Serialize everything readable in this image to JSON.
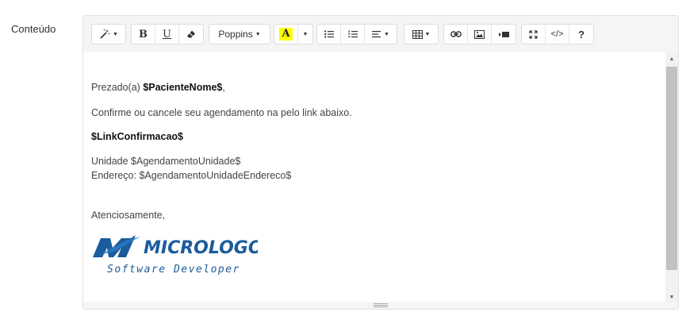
{
  "field": {
    "label": "Conteúdo"
  },
  "toolbar": {
    "font_name": "Poppins",
    "highlight_label": "A",
    "help_label": "?",
    "code_label": "</>"
  },
  "content": {
    "greeting_prefix": "Prezado(a) ",
    "patient_var": "$PacienteNome$",
    "greeting_suffix": ",",
    "confirm_text": "Confirme ou cancele seu agendamento na  pelo link abaixo.",
    "link_var": "$LinkConfirmacao$",
    "unit_line": "Unidade $AgendamentoUnidade$",
    "address_line": "Endereço: $AgendamentoUnidadeEndereco$",
    "closing": "Atenciosamente,"
  },
  "logo": {
    "name": "MICROLOGOS",
    "tagline": "Software Developer",
    "color": "#1b5c9c"
  }
}
